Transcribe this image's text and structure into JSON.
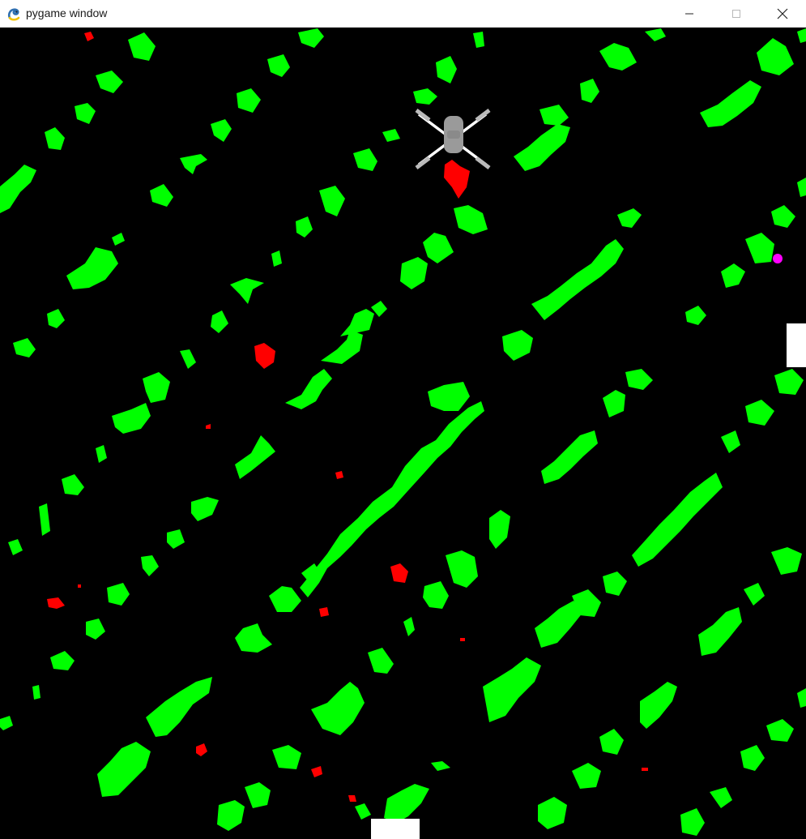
{
  "window": {
    "title": "pygame window",
    "icon": "pygame-snake-icon",
    "controls": {
      "minimize_icon": "minimize-icon",
      "maximize_icon": "maximize-icon",
      "close_icon": "close-icon"
    }
  },
  "game": {
    "background_color": "#000000",
    "crop_color": "#00ff00",
    "weed_color": "#ff0000",
    "drone_color": "#9a9a9a",
    "rotor_color": "#ffffff",
    "target_color": "#ff00ff",
    "station_color": "#ffffff",
    "sprites": {
      "drone": "quadcopter-drone",
      "target": "magenta-target-dot",
      "stations": [
        "white-block-right",
        "white-block-bottom"
      ]
    }
  }
}
